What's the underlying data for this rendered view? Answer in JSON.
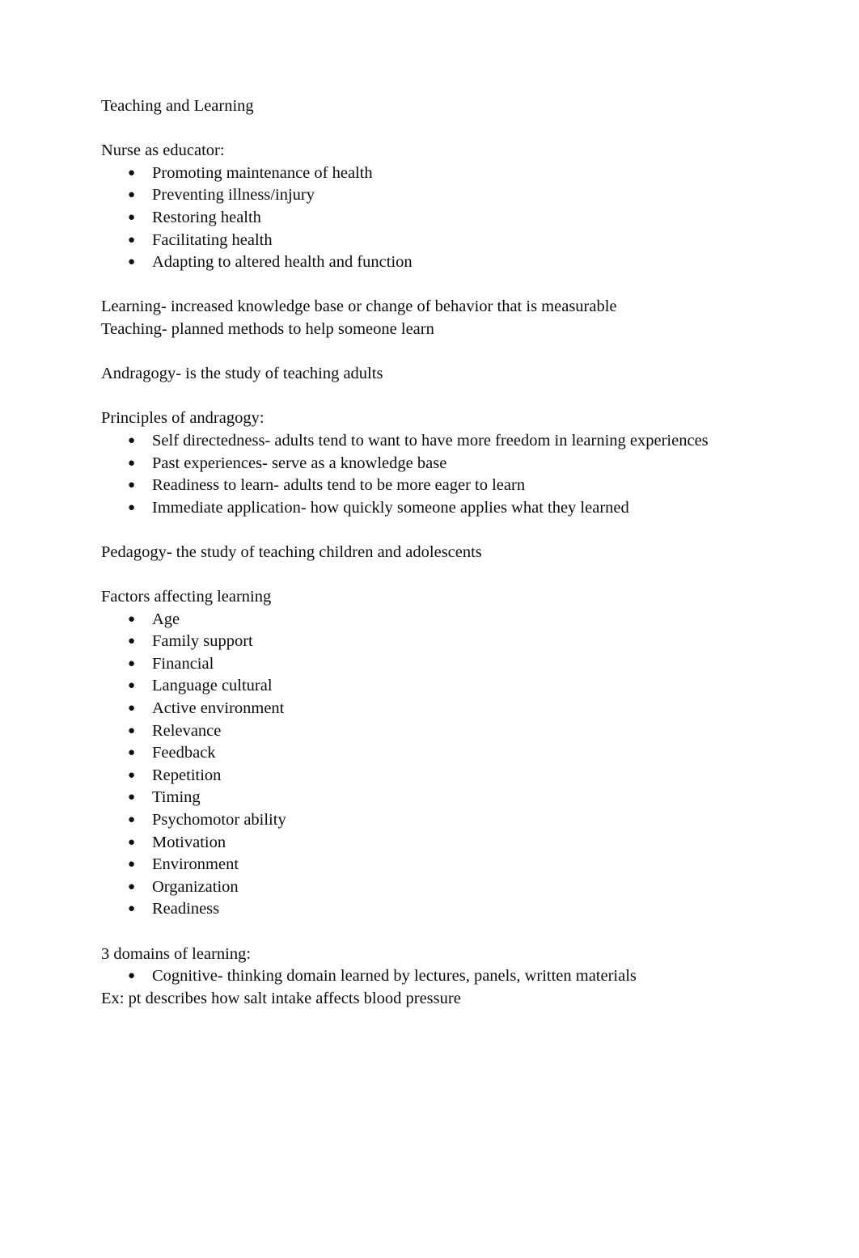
{
  "document": {
    "title": "Teaching and Learning",
    "text_color": "#0d0d0d",
    "background_color": "#ffffff",
    "bullet_glyph": "●",
    "blocks": [
      {
        "type": "paragraph",
        "name": "doc-title",
        "text": "Teaching and Learning"
      },
      {
        "type": "blank",
        "name": "spacer"
      },
      {
        "type": "paragraph",
        "name": "heading-nurse-as-educator",
        "text": "Nurse as educator:"
      },
      {
        "type": "list",
        "name": "list-nurse-as-educator",
        "items": [
          "Promoting maintenance of health",
          "Preventing illness/injury",
          "Restoring health",
          "Facilitating health",
          "Adapting to altered health and function"
        ]
      },
      {
        "type": "blank",
        "name": "spacer"
      },
      {
        "type": "paragraph",
        "name": "definition-learning",
        "text": "Learning- increased knowledge base or change of behavior that is measurable"
      },
      {
        "type": "paragraph",
        "name": "definition-teaching",
        "text": "Teaching- planned methods to help someone learn"
      },
      {
        "type": "blank",
        "name": "spacer"
      },
      {
        "type": "paragraph",
        "name": "definition-andragogy",
        "text": "Andragogy- is the study of teaching adults"
      },
      {
        "type": "blank",
        "name": "spacer"
      },
      {
        "type": "paragraph",
        "name": "heading-principles-of-andragogy",
        "text": "Principles of andragogy:"
      },
      {
        "type": "list",
        "name": "list-principles-of-andragogy",
        "items": [
          "Self directedness- adults tend to want to have more freedom in learning experiences",
          "Past experiences- serve as a knowledge base",
          "Readiness to learn- adults tend to be more eager to learn",
          "Immediate application- how quickly someone applies what they learned"
        ]
      },
      {
        "type": "blank",
        "name": "spacer"
      },
      {
        "type": "paragraph",
        "name": "definition-pedagogy",
        "text": "Pedagogy- the study of teaching children and adolescents"
      },
      {
        "type": "blank",
        "name": "spacer"
      },
      {
        "type": "paragraph",
        "name": "heading-factors-affecting-learning",
        "text": "Factors affecting learning"
      },
      {
        "type": "list",
        "name": "list-factors-affecting-learning",
        "items": [
          "Age",
          "Family support",
          "Financial",
          "Language cultural",
          "Active environment",
          "Relevance",
          "Feedback",
          "Repetition",
          "Timing",
          "Psychomotor ability",
          "Motivation",
          "Environment",
          "Organization",
          "Readiness"
        ]
      },
      {
        "type": "blank",
        "name": "spacer"
      },
      {
        "type": "paragraph",
        "name": "heading-3-domains-of-learning",
        "text": "3 domains of learning:"
      },
      {
        "type": "list",
        "name": "list-domains-of-learning",
        "items": [
          "Cognitive- thinking domain learned by lectures, panels, written materials"
        ]
      },
      {
        "type": "paragraph",
        "name": "example-cognitive-domain",
        "text": "Ex: pt describes how salt intake affects blood pressure"
      }
    ]
  }
}
